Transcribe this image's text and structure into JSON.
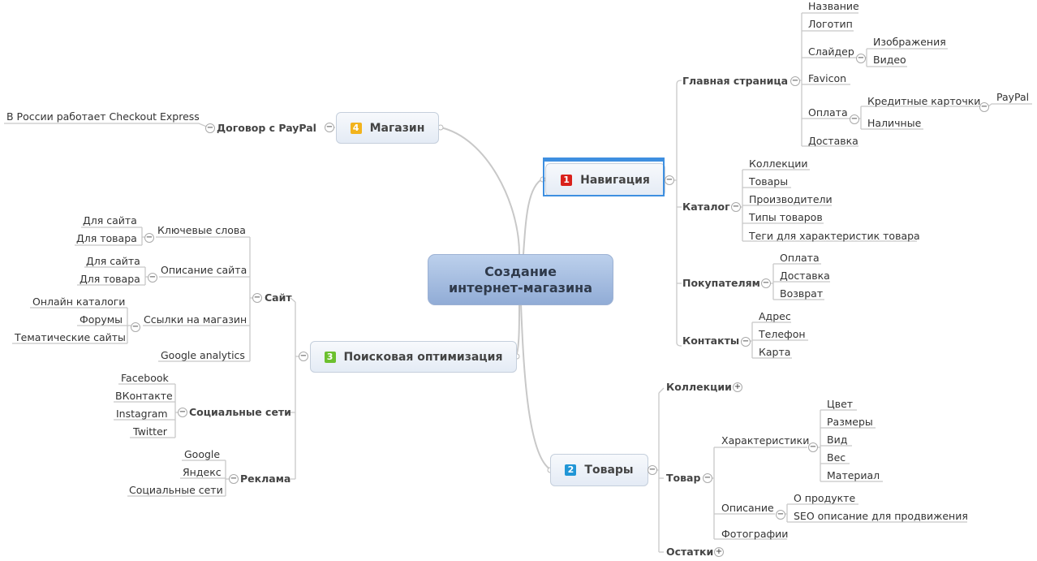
{
  "central": {
    "line1": "Создание",
    "line2": "интернет-магазина"
  },
  "colors": {
    "badge1": "#d9211b",
    "badge2": "#2196d6",
    "badge3": "#6cc02e",
    "badge4": "#f2b31c",
    "selection": "#3e8fe0",
    "central_fill": "#a7bfe2",
    "line": "#c8c8c8"
  },
  "topics": {
    "nav": {
      "num": "1",
      "label": "Навигация"
    },
    "goods": {
      "num": "2",
      "label": "Товары"
    },
    "seo": {
      "num": "3",
      "label": "Поисковая оптимизация"
    },
    "shop": {
      "num": "4",
      "label": "Магазин"
    }
  },
  "toggle": {
    "collapse": "−",
    "expand": "+"
  },
  "nav": {
    "main": {
      "label": "Главная страница",
      "children": [
        "Название",
        "Логотип",
        "Слайдер",
        "Favicon",
        "Оплата",
        "Доставка"
      ],
      "slider_children": [
        "Изображения",
        "Видео"
      ],
      "payment_children": [
        "Кредитные карточки",
        "Наличные"
      ],
      "cards_children": [
        "PayPal"
      ]
    },
    "catalog": {
      "label": "Каталог",
      "children": [
        "Коллекции",
        "Товары",
        "Производители",
        "Типы товаров",
        "Теги для характеристик товара"
      ]
    },
    "buyers": {
      "label": "Покупателям",
      "children": [
        "Оплата",
        "Доставка",
        "Возврат"
      ]
    },
    "contacts": {
      "label": "Контакты",
      "children": [
        "Адрес",
        "Телефон",
        "Карта"
      ]
    }
  },
  "goods": {
    "collections": {
      "label": "Коллекции"
    },
    "item": {
      "label": "Товар",
      "chars": {
        "label": "Характеристики",
        "children": [
          "Цвет",
          "Размеры",
          "Вид",
          "Вес",
          "Материал"
        ]
      },
      "desc": {
        "label": "Описание",
        "children": [
          "О продукте",
          "SEO описание для продвижения"
        ]
      },
      "photos": {
        "label": "Фотографии"
      }
    },
    "stock": {
      "label": "Остатки"
    }
  },
  "seo": {
    "site": {
      "label": "Сайт",
      "keywords": {
        "label": "Ключевые слова",
        "children": [
          "Для сайта",
          "Для товара"
        ]
      },
      "description": {
        "label": "Описание сайта",
        "children": [
          "Для сайта",
          "Для товара"
        ]
      },
      "links": {
        "label": "Ссылки на магазин",
        "children": [
          "Онлайн каталоги",
          "Форумы",
          "Тематические сайты"
        ]
      },
      "analytics": {
        "label": "Google analytics"
      }
    },
    "social": {
      "label": "Социальные сети",
      "children": [
        "Facebook",
        "ВКонтакте",
        "Instagram",
        "Twitter"
      ]
    },
    "ads": {
      "label": "Реклама",
      "children": [
        "Google",
        "Яндекс",
        "Социальные сети"
      ]
    }
  },
  "shop": {
    "paypal": {
      "label": "Договор с PayPal",
      "children": [
        "В России работает Checkout Express"
      ]
    }
  }
}
